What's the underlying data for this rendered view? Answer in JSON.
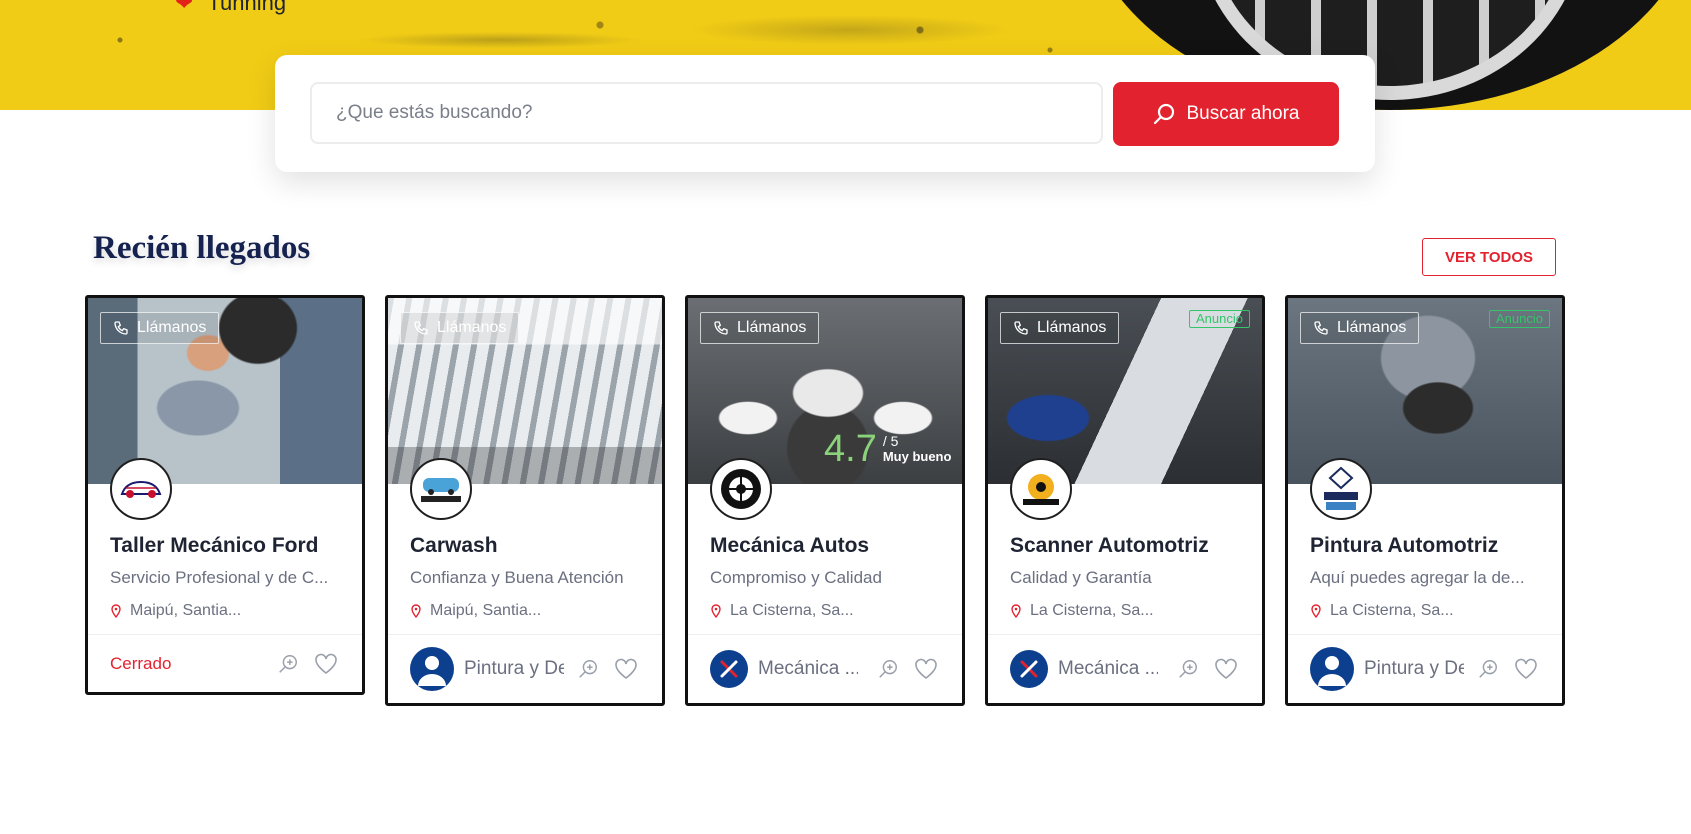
{
  "hero": {
    "tagline": "Tunning"
  },
  "search": {
    "placeholder": "¿Que estás buscando?",
    "button_label": "Buscar ahora"
  },
  "section": {
    "title": "Recién llegados",
    "view_all_label": "VER TODOS"
  },
  "call_label": "Llámanos",
  "ad_label": "Anuncio",
  "cards": [
    {
      "title": "Taller Mecánico Ford",
      "subtitle": "Servicio Profesional y de C...",
      "location": "Maipú, Santia...",
      "status": "Cerrado"
    },
    {
      "title": "Carwash",
      "subtitle": "Confianza y Buena Atención",
      "location": "Maipú, Santia...",
      "owner": "Pintura y De"
    },
    {
      "title": "Mecánica Autos",
      "subtitle": "Compromiso y Calidad",
      "location": "La Cisterna, Sa...",
      "owner": "Mecánica ...",
      "rating": "4.7",
      "rating_max": "/ 5",
      "rating_label": "Muy bueno"
    },
    {
      "title": "Scanner Automotriz",
      "subtitle": "Calidad y Garantía",
      "location": "La Cisterna, Sa...",
      "owner": "Mecánica ...",
      "ad": true
    },
    {
      "title": "Pintura Automotriz",
      "subtitle": "Aquí puedes agregar la de...",
      "location": "La Cisterna, Sa...",
      "owner": "Pintura y De",
      "ad": true
    }
  ],
  "colors": {
    "accent": "#e2232f",
    "hero_yellow": "#f1cc16",
    "title_navy": "#15224f",
    "rating_green": "#8bd37a",
    "ad_green": "#35c46a"
  }
}
